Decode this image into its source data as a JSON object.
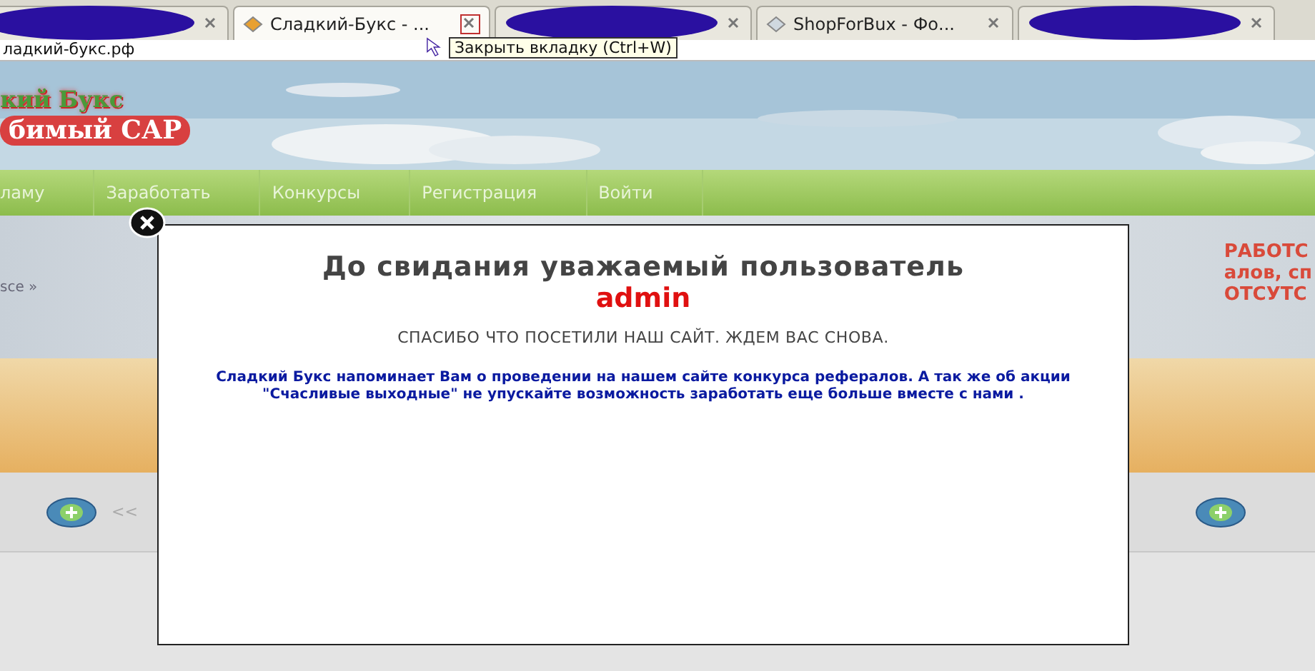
{
  "browser": {
    "tabs": [
      {
        "kind": "redacted",
        "selected": false
      },
      {
        "kind": "page",
        "label": "Сладкий-Букс - ...",
        "selected": true
      },
      {
        "kind": "redacted",
        "selected": false
      },
      {
        "kind": "page",
        "label": "ShopForBux - Фо...",
        "selected": false
      },
      {
        "kind": "redacted",
        "selected": false
      }
    ],
    "tooltip": "Закрыть вкладку (Ctrl+W)",
    "address": "ладкий-букс.рф"
  },
  "site": {
    "logo_title": "кий Букс",
    "logo_subtitle": "бимый САР",
    "nav": [
      "ламу",
      "Заработать",
      "Конкурсы",
      "Регистрация",
      "Войти"
    ],
    "breadcrumb": "sce »",
    "side_text": [
      "РАБОТС",
      "алов, сп",
      "ОТСУТС"
    ],
    "pager": "<<"
  },
  "modal": {
    "title": "До свидания уважаемый пользователь",
    "username": "admin",
    "subtitle": "СПАСИБО ЧТО ПОСЕТИЛИ НАШ САЙТ. ЖДЕМ ВАС СНОВА.",
    "message": "Сладкий Букс напоминает Вам о проведении на нашем сайте конкурса рефералов. А так же об акции \"Счасливые выходные\" не упускайте возможность заработать еще больше вместе с нами ."
  }
}
